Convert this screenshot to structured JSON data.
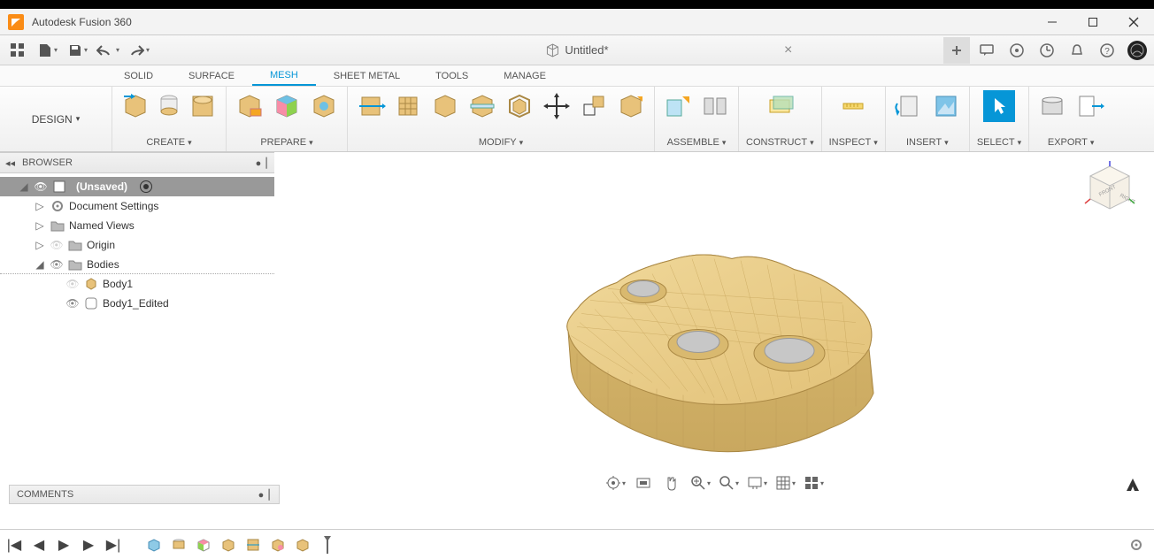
{
  "titlebar": {
    "title": "Autodesk Fusion 360"
  },
  "qat": {
    "doc_title": "Untitled*"
  },
  "ribbon_tabs": {
    "solid": "SOLID",
    "surface": "SURFACE",
    "mesh": "MESH",
    "sheet_metal": "SHEET METAL",
    "tools": "TOOLS",
    "manage": "MANAGE"
  },
  "ribbon": {
    "design": "DESIGN",
    "create": "CREATE",
    "prepare": "PREPARE",
    "modify": "MODIFY",
    "assemble": "ASSEMBLE",
    "construct": "CONSTRUCT",
    "inspect": "INSPECT",
    "insert": "INSERT",
    "select": "SELECT",
    "export": "EXPORT"
  },
  "browser": {
    "header": "BROWSER",
    "root": "(Unsaved)",
    "document_settings": "Document Settings",
    "named_views": "Named Views",
    "origin": "Origin",
    "bodies": "Bodies",
    "body1": "Body1",
    "body1_edited": "Body1_Edited"
  },
  "comments": {
    "label": "COMMENTS"
  }
}
